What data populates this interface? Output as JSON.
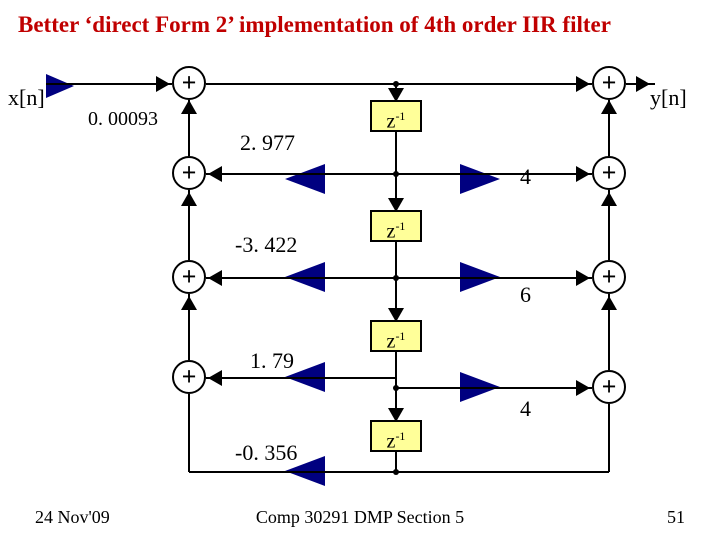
{
  "title": "Better ‘direct Form 2’ implementation of 4th order IIR filter",
  "input_label": "x[n]",
  "output_label": "y[n]",
  "gain_in": "0. 00093",
  "coefs": {
    "a1": "2. 977",
    "a2": "-3. 422",
    "a3": "1. 79",
    "a4": "-0. 356",
    "b1": "4",
    "b2": "6",
    "b3": "4"
  },
  "delay_label_html": "z<sup>-1</sup>",
  "adder_sym": "+",
  "footer": {
    "left": "24 Nov'09",
    "center": "Comp 30291 DMP Section 5",
    "right": "51"
  }
}
